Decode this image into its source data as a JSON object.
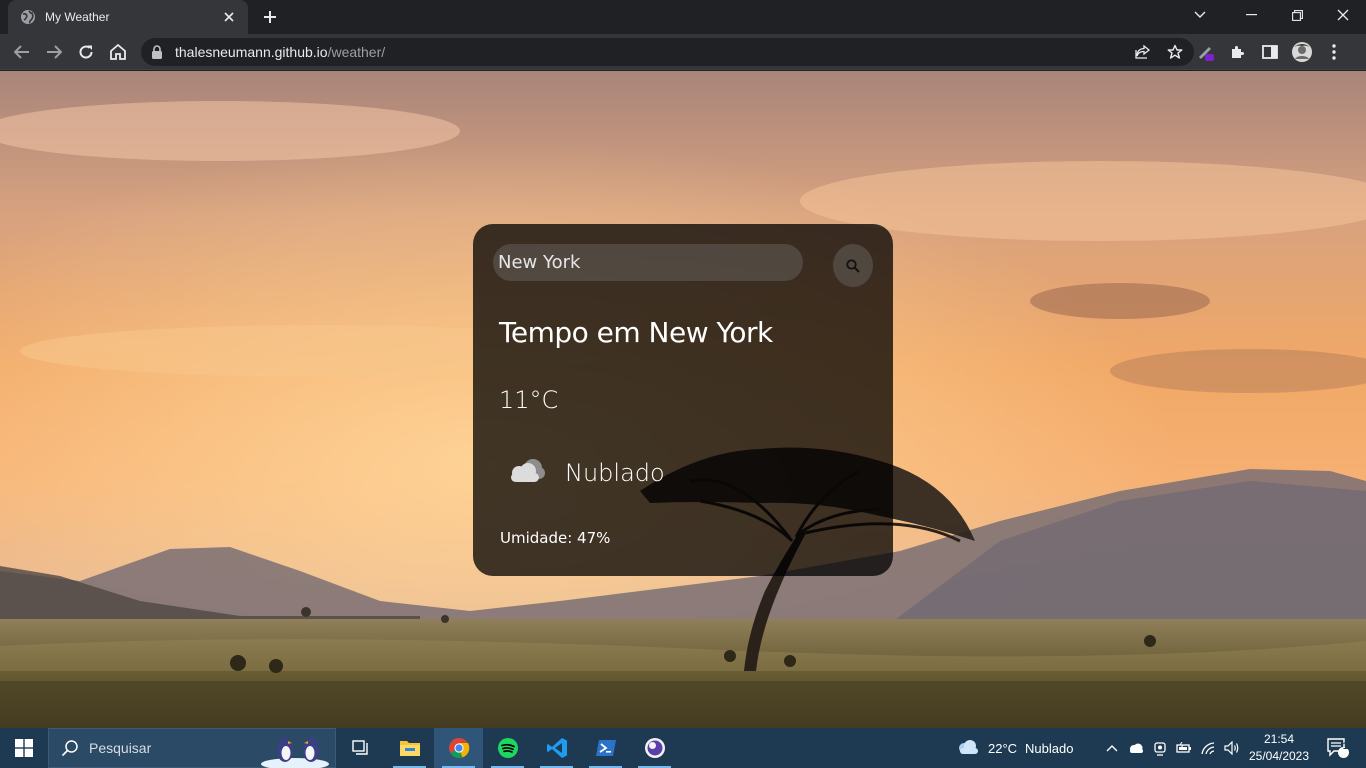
{
  "browser": {
    "tab_title": "My Weather",
    "url_host": "thalesneumann.github.io",
    "url_path": "/weather/"
  },
  "weather_app": {
    "search_value": "New York",
    "title": "Tempo em New York",
    "temperature": "11°C",
    "description": "Nublado",
    "humidity": "Umidade: 47%",
    "icon": "cloud-icon"
  },
  "taskbar": {
    "search_placeholder": "Pesquisar",
    "weather_temp": "22°C",
    "weather_desc": "Nublado",
    "time": "21:54",
    "date": "25/04/2023",
    "notification_count": "1",
    "apps": [
      "task-view",
      "file-explorer",
      "chrome",
      "spotify",
      "vscode",
      "powershell",
      "app-launcher"
    ]
  },
  "colors": {
    "chrome_dark": "#202124",
    "chrome_toolbar": "#35363a",
    "card_bg": "rgba(0,0,0,0.75)",
    "taskbar_bg": "#1e3a52",
    "sky_top": "#b88a78",
    "sky_glow": "#f0a060"
  }
}
